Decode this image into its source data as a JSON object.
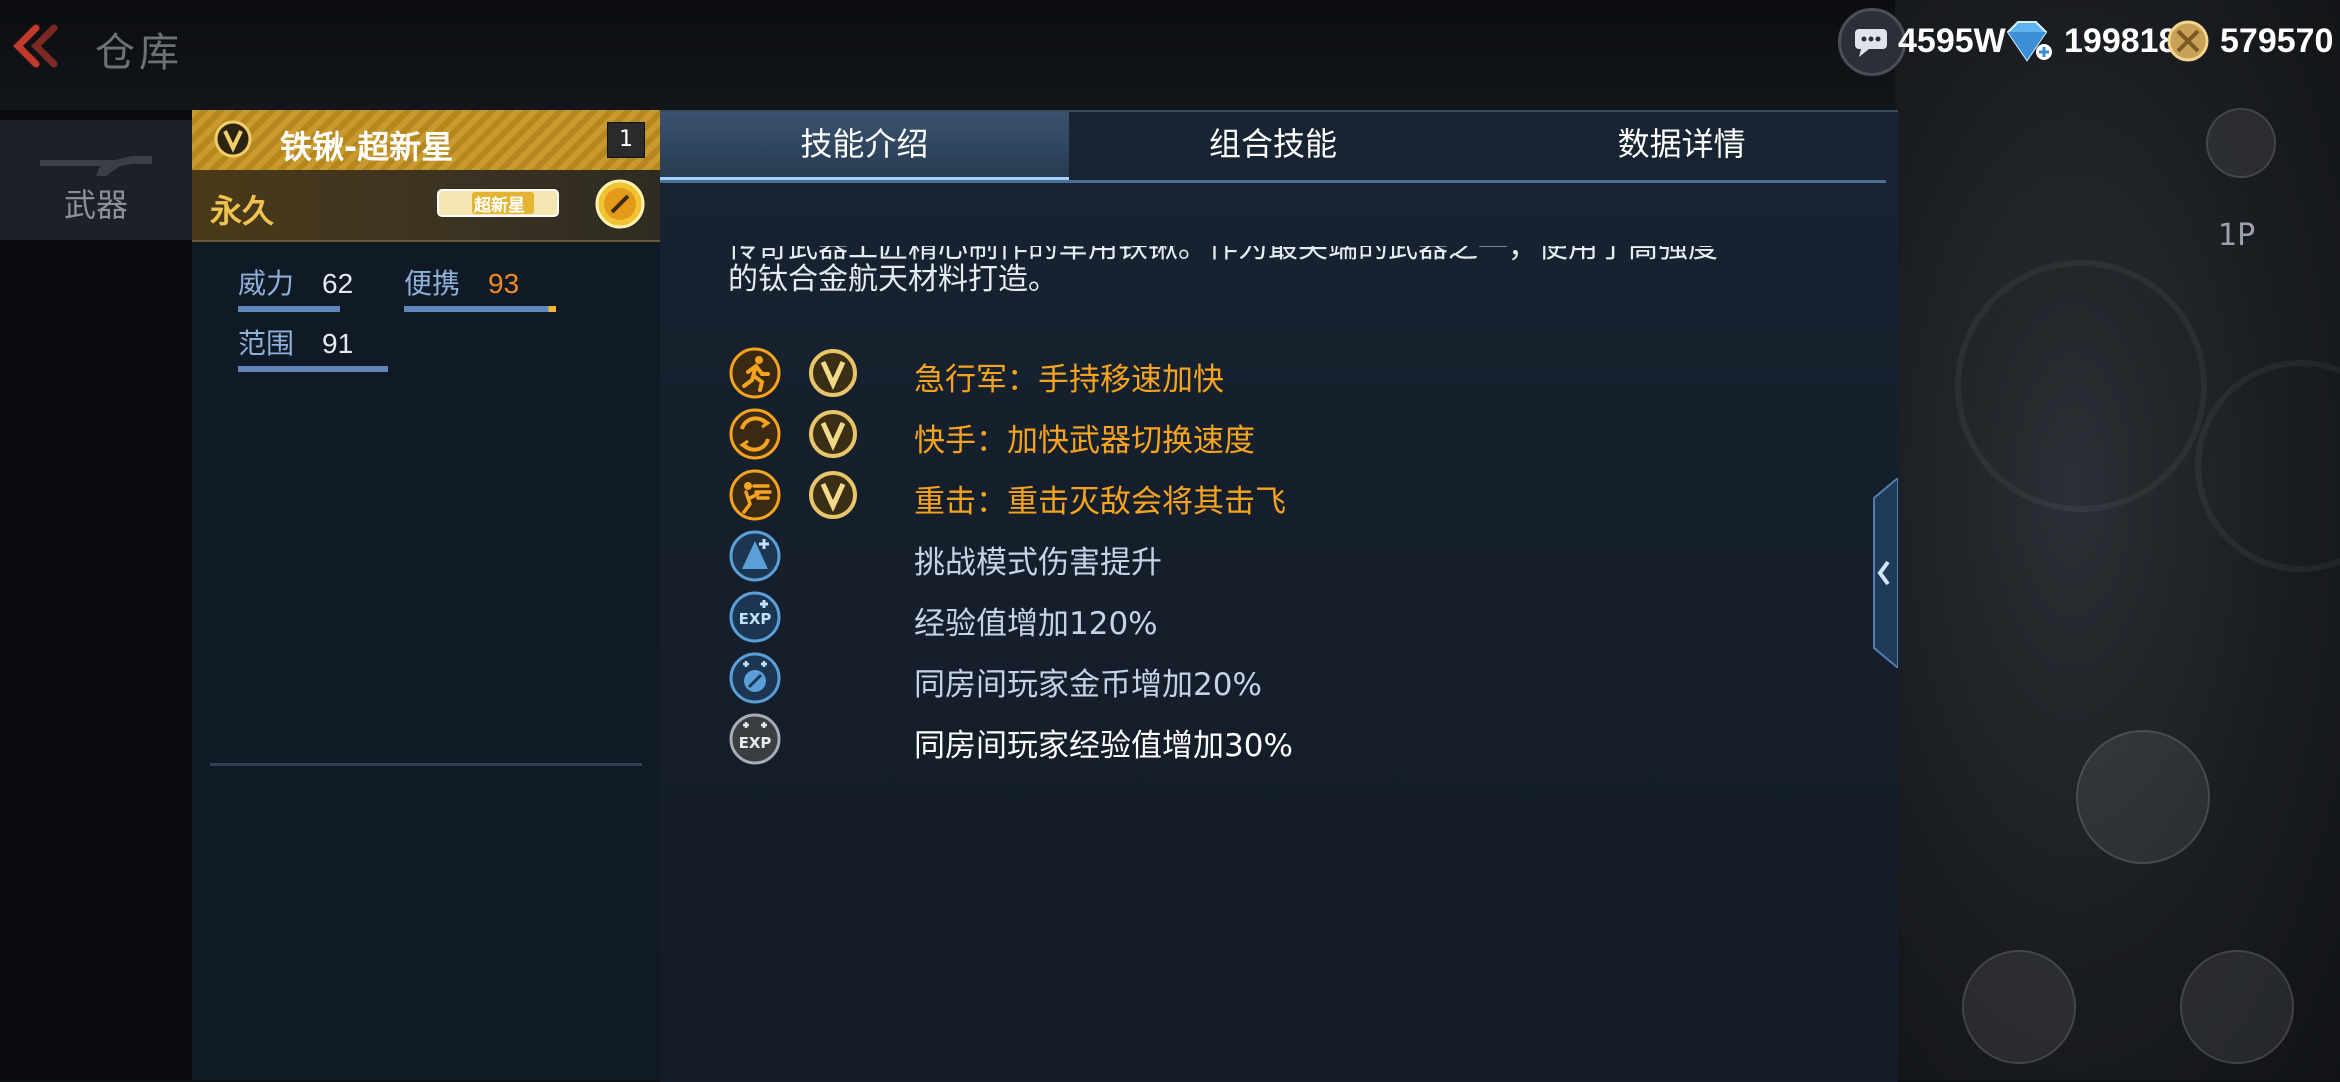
{
  "topbar": {
    "title": "仓库",
    "currencies": [
      {
        "name": "gold-coin",
        "amount": "4595W"
      },
      {
        "name": "diamond",
        "amount": "199818"
      },
      {
        "name": "honor-coin",
        "amount": "579570"
      }
    ]
  },
  "sidebar": {
    "weapon_tab_label": "武器"
  },
  "item": {
    "name": "铁锹-超新星",
    "count": "1",
    "duration": "永久",
    "tag_label": "超新星",
    "stats": [
      {
        "label": "威力",
        "value": "62",
        "fraction": 0.5
      },
      {
        "label": "便携",
        "value": "93",
        "fraction": 0.95
      },
      {
        "label": "范围",
        "value": "91",
        "fraction": 0.93
      }
    ]
  },
  "tabs": [
    {
      "label": "技能介绍",
      "active": true
    },
    {
      "label": "组合技能",
      "active": false
    },
    {
      "label": "数据详情",
      "active": false
    }
  ],
  "description": {
    "line1": "传奇武器工匠精心制作的军用铁锹。作为最尖端的武器之一，使用了高强度",
    "line2": "的钛合金航天材料打造。"
  },
  "skills": [
    {
      "text": "急行军：手持移速加快",
      "icon": "running-man-icon",
      "vip": true,
      "color": "gold"
    },
    {
      "text": "快手：加快武器切换速度",
      "icon": "weapon-switch-icon",
      "vip": true,
      "color": "gold"
    },
    {
      "text": "重击：重击灭敌会将其击飞",
      "icon": "heavy-strike-icon",
      "vip": true,
      "color": "gold"
    },
    {
      "text": "挑战模式伤害提升",
      "icon": "challenge-damage-icon",
      "vip": false,
      "color": "blue"
    },
    {
      "text": "经验值增加120%",
      "icon": "exp-boost-icon",
      "vip": false,
      "color": "blue"
    },
    {
      "text": "同房间玩家金币增加20%",
      "icon": "room-coin-icon",
      "vip": false,
      "color": "blue"
    },
    {
      "text": "同房间玩家经验值增加30%",
      "icon": "room-exp-icon",
      "vip": false,
      "color": "white"
    }
  ],
  "right_controls": {
    "p1_label": "1P"
  },
  "colors": {
    "gold_text": "#f6a31f",
    "tab_active": "#2f465f",
    "panel": "#162130",
    "stat_highlight": "#f08a24"
  }
}
